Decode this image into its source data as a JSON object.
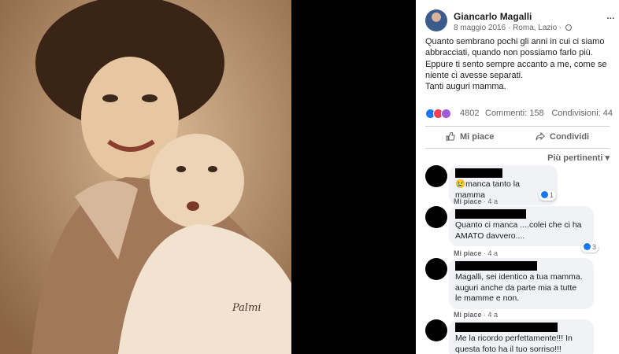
{
  "post": {
    "author": "Giancarlo Magalli",
    "date": "8 maggio 2016",
    "location": "Roma, Lazio",
    "separator": "·",
    "more_glyph": "...",
    "text_lines": [
      "Quanto sembrano pochi gli anni in cui ci siamo",
      "abbracciati, quando non possiamo farlo più.",
      "Eppure ti sento sempre accanto a me, come se",
      "niente ci avesse separati.",
      "Tanti auguri mamma."
    ]
  },
  "stats": {
    "reactions_count": "4802",
    "comments_label": "Commenti: 158",
    "shares_label": "Condivisioni: 44",
    "reaction_icons": [
      "like-icon",
      "love-icon",
      "care-icon"
    ]
  },
  "actions": {
    "like_label": "Mi piace",
    "share_label": "Condividi"
  },
  "sort_label": "Più pertinenti",
  "comments": [
    {
      "lines": [
        "😢manca tanto la mamma"
      ],
      "like_label": "Mi piace",
      "time": "4 a",
      "reactions": "1"
    },
    {
      "lines": [
        "Quanto ci manca ....colei che ci ha",
        "AMATO davvero...."
      ],
      "like_label": "Mi piace",
      "time": "4 a",
      "reactions": "3"
    },
    {
      "lines": [
        "Magalli, sei identico a tua mamma.",
        "auguri anche da parte mia a tutte",
        "le mamme e non."
      ],
      "like_label": "Mi piace",
      "time": "4 a",
      "reactions": ""
    },
    {
      "lines": [
        "Me la ricordo perfettamente!!! In",
        "questa foto ha il tuo sorriso!!!"
      ],
      "like_label": "",
      "time": "",
      "reactions": ""
    }
  ],
  "photo": {
    "signature": "Palmi"
  },
  "colors": {
    "accent": "#1877f2",
    "love": "#f33e58",
    "bubble": "#f0f2f5",
    "muted": "#65676b",
    "sepia": "#b48a62"
  }
}
